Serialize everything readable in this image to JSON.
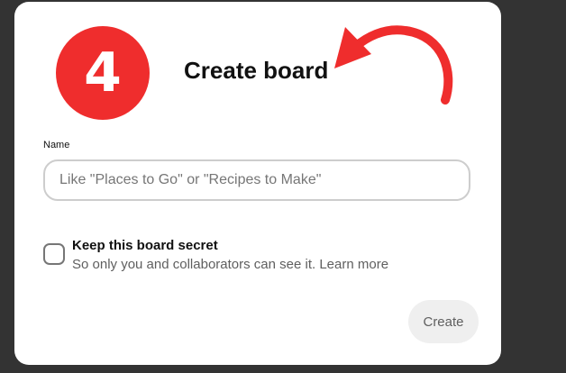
{
  "modal": {
    "step_number": "4",
    "title": "Create board",
    "name_field": {
      "label": "Name",
      "value": "",
      "placeholder": "Like \"Places to Go\" or \"Recipes to Make\""
    },
    "secret_option": {
      "checked": false,
      "title": "Keep this board secret",
      "description": "So only you and collaborators can see it. Learn more"
    },
    "create_button_label": "Create"
  },
  "colors": {
    "backdrop": "#333333",
    "badge": "#ef2d2d",
    "arrow": "#ef2d2d",
    "button_bg": "#efefef"
  },
  "icons": {
    "annotation": "curved-arrow-icon",
    "checkbox": "checkbox-unchecked-icon"
  }
}
